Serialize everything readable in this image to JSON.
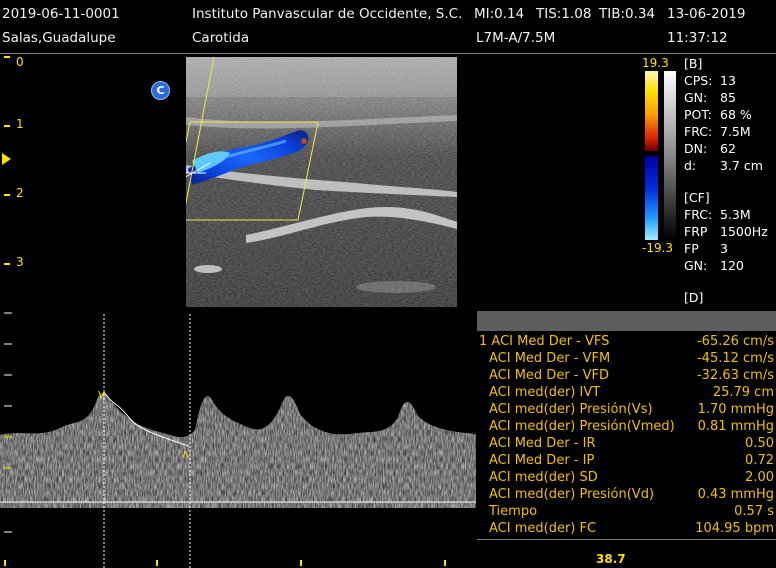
{
  "header": {
    "study_id": "2019-06-11-0001",
    "institution": "Instituto Panvascular de Occidente, S.C.",
    "mi": "MI:0.14",
    "tis": "TIS:1.08",
    "tib": "TIB:0.34",
    "date": "13-06-2019",
    "patient": "Salas,Guadalupe",
    "exam": "Carotida",
    "probe": "L7M-A/7.5M",
    "time": "11:37:12"
  },
  "depth_scale": [
    "0",
    "1",
    "2",
    "3"
  ],
  "marker_c": "C",
  "color_bar": {
    "max": "19.3",
    "min": "-19.3"
  },
  "bmode_params": {
    "section": "[B]",
    "rows": [
      {
        "label": "CPS:",
        "value": "13"
      },
      {
        "label": "GN:",
        "value": "85"
      },
      {
        "label": "POT:",
        "value": "68 %"
      },
      {
        "label": "FRC:",
        "value": "7.5M"
      },
      {
        "label": "DN:",
        "value": "62"
      },
      {
        "label": "d:",
        "value": "3.7 cm"
      }
    ]
  },
  "cf_params": {
    "section": "[CF]",
    "rows": [
      {
        "label": "FRC:",
        "value": "5.3M"
      },
      {
        "label": "FRP",
        "value": "1500Hz"
      },
      {
        "label": "FP",
        "value": "3"
      },
      {
        "label": "GN:",
        "value": "120"
      }
    ]
  },
  "d_section": "[D]",
  "measurements": [
    {
      "label": "1 ACI Med Der - VFS",
      "value": "-65.26 cm/s"
    },
    {
      "label": "ACI Med Der - VFM",
      "value": "-45.12 cm/s"
    },
    {
      "label": "ACI Med Der - VFD",
      "value": "-32.63 cm/s"
    },
    {
      "label": "ACI med(der) IVT",
      "value": "25.79 cm"
    },
    {
      "label": "ACI med(der) Presión(Vs)",
      "value": "1.70 mmHg"
    },
    {
      "label": "ACI med(der) Presión(Vmed)",
      "value": "0.81 mmHg"
    },
    {
      "label": "ACI Med Der - IR",
      "value": "0.50"
    },
    {
      "label": "ACI Med Der - IP",
      "value": "0.72"
    },
    {
      "label": "ACI med(der) SD",
      "value": "2.00"
    },
    {
      "label": "ACI med(der) Presión(Vd)",
      "value": "0.43 mmHg"
    },
    {
      "label": "Tiempo",
      "value": "0.57 s"
    },
    {
      "label": "ACI med(der) FC",
      "value": "104.95 bpm"
    }
  ],
  "bottom_readout": "38.7"
}
